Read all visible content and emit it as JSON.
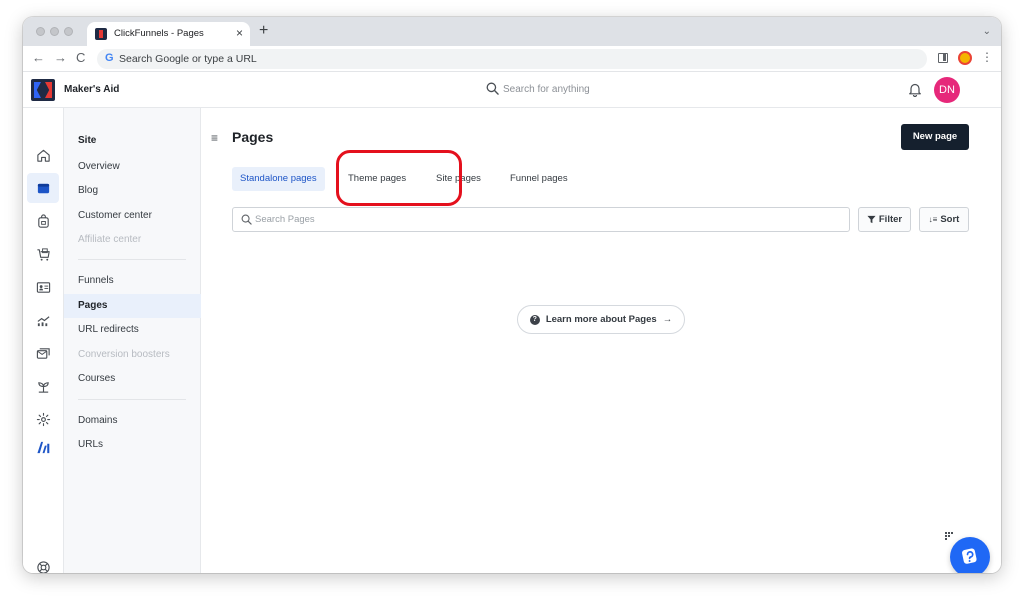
{
  "browser": {
    "tab_title": "ClickFunnels - Pages",
    "tab_close": "×",
    "new_tab": "+",
    "omnibox_placeholder": "Search Google or type a URL",
    "back": "←",
    "forward": "→",
    "reload": "C",
    "menu": "⋮",
    "tabs_menu": "⌄",
    "google_glyph": "G"
  },
  "header": {
    "workspace_name": "Maker's Aid",
    "search_placeholder": "Search for anything",
    "avatar_initials": "DN",
    "avatar_color": "#e6287a"
  },
  "rail": {
    "items": [
      {
        "icon": "home-icon",
        "active": false
      },
      {
        "icon": "site-icon",
        "active": true
      },
      {
        "icon": "store-icon",
        "active": false
      },
      {
        "icon": "cart-icon",
        "active": false
      },
      {
        "icon": "contacts-icon",
        "active": false
      },
      {
        "icon": "analytics-icon",
        "active": false
      },
      {
        "icon": "email-icon",
        "active": false
      },
      {
        "icon": "automation-icon",
        "active": false
      },
      {
        "icon": "settings-icon",
        "active": false
      },
      {
        "icon": "ai-icon",
        "active": false
      },
      {
        "icon": "help-icon",
        "active": false
      }
    ]
  },
  "subnav": {
    "heading": "Site",
    "group1": [
      "Overview",
      "Blog",
      "Customer center",
      "Affiliate center"
    ],
    "group2": [
      "Funnels",
      "Pages",
      "URL redirects",
      "Conversion boosters",
      "Courses"
    ],
    "group3": [
      "Domains",
      "URLs"
    ],
    "active": "Pages",
    "disabled": [
      "Affiliate center",
      "Conversion boosters"
    ]
  },
  "main": {
    "title": "Pages",
    "new_page_label": "New page",
    "tabs": [
      "Standalone pages",
      "Theme pages",
      "Site pages",
      "Funnel pages"
    ],
    "active_tab": "Standalone pages",
    "search_placeholder": "Search Pages",
    "filter_label": "Filter",
    "sort_label": "Sort",
    "learn_more_label": "Learn more about Pages",
    "help_glyph": "?",
    "arrow_glyph": "→",
    "hamburger_glyph": "≡",
    "sort_glyph": "↓≡"
  },
  "colors": {
    "accent": "#1d55c7",
    "primary_button": "#15202e",
    "highlight": "#e4101d",
    "support_bubble": "#1f68f5"
  }
}
